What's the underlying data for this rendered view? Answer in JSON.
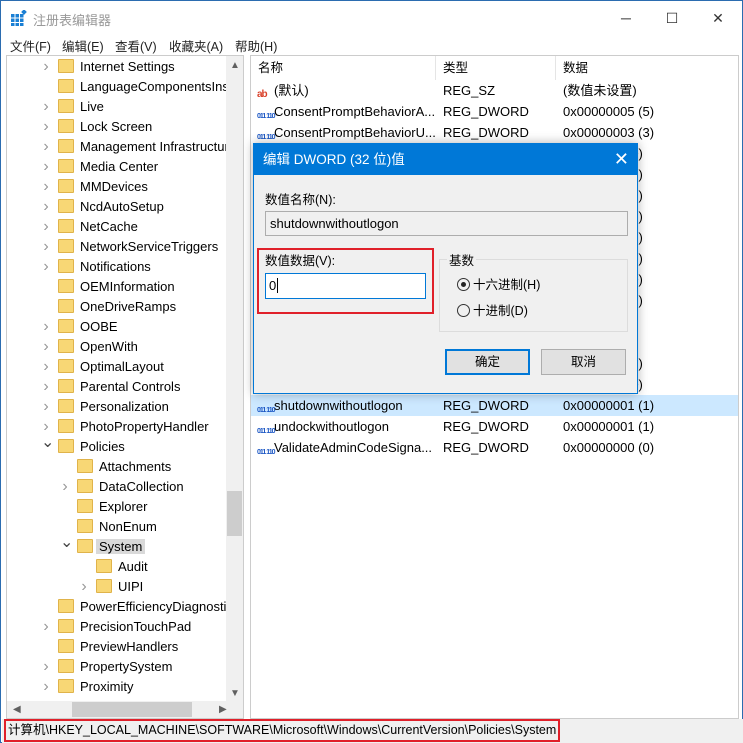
{
  "window": {
    "title": "注册表编辑器",
    "minimize": "─",
    "maximize": "☐",
    "close": "✕"
  },
  "menu": [
    "文件(F)",
    "编辑(E)",
    "查看(V)",
    "收藏夹(A)",
    "帮助(H)"
  ],
  "tree": [
    {
      "label": "Internet Settings",
      "level": 0,
      "exp": ">"
    },
    {
      "label": "LanguageComponentsInst",
      "level": 0,
      "exp": ""
    },
    {
      "label": "Live",
      "level": 0,
      "exp": ">"
    },
    {
      "label": "Lock Screen",
      "level": 0,
      "exp": ">"
    },
    {
      "label": "Management Infrastructur",
      "level": 0,
      "exp": ">"
    },
    {
      "label": "Media Center",
      "level": 0,
      "exp": ">"
    },
    {
      "label": "MMDevices",
      "level": 0,
      "exp": ">"
    },
    {
      "label": "NcdAutoSetup",
      "level": 0,
      "exp": ">"
    },
    {
      "label": "NetCache",
      "level": 0,
      "exp": ">"
    },
    {
      "label": "NetworkServiceTriggers",
      "level": 0,
      "exp": ">"
    },
    {
      "label": "Notifications",
      "level": 0,
      "exp": ">"
    },
    {
      "label": "OEMInformation",
      "level": 0,
      "exp": ""
    },
    {
      "label": "OneDriveRamps",
      "level": 0,
      "exp": ""
    },
    {
      "label": "OOBE",
      "level": 0,
      "exp": ">"
    },
    {
      "label": "OpenWith",
      "level": 0,
      "exp": ">"
    },
    {
      "label": "OptimalLayout",
      "level": 0,
      "exp": ">"
    },
    {
      "label": "Parental Controls",
      "level": 0,
      "exp": ">"
    },
    {
      "label": "Personalization",
      "level": 0,
      "exp": ">"
    },
    {
      "label": "PhotoPropertyHandler",
      "level": 0,
      "exp": ">"
    },
    {
      "label": "Policies",
      "level": 0,
      "exp": "v"
    },
    {
      "label": "Attachments",
      "level": 1,
      "exp": ""
    },
    {
      "label": "DataCollection",
      "level": 1,
      "exp": ">"
    },
    {
      "label": "Explorer",
      "level": 1,
      "exp": ""
    },
    {
      "label": "NonEnum",
      "level": 1,
      "exp": ""
    },
    {
      "label": "System",
      "level": 1,
      "exp": "v",
      "selected": true
    },
    {
      "label": "Audit",
      "level": 2,
      "exp": ""
    },
    {
      "label": "UIPI",
      "level": 2,
      "exp": ">"
    },
    {
      "label": "PowerEfficiencyDiagnostic",
      "level": 0,
      "exp": ""
    },
    {
      "label": "PrecisionTouchPad",
      "level": 0,
      "exp": ">"
    },
    {
      "label": "PreviewHandlers",
      "level": 0,
      "exp": ""
    },
    {
      "label": "PropertySystem",
      "level": 0,
      "exp": ">"
    },
    {
      "label": "Proximity",
      "level": 0,
      "exp": ">"
    }
  ],
  "list": {
    "headers": [
      "名称",
      "类型",
      "数据"
    ],
    "rows": [
      {
        "icon": "string-value-icon",
        "name": "(默认)",
        "type": "REG_SZ",
        "data": "(数值未设置)"
      },
      {
        "icon": "dword-value-icon",
        "name": "ConsentPromptBehaviorA...",
        "type": "REG_DWORD",
        "data": "0x00000005 (5)"
      },
      {
        "icon": "dword-value-icon",
        "name": "ConsentPromptBehaviorU...",
        "type": "REG_DWORD",
        "data": "0x00000003 (3)"
      },
      {
        "icon": "",
        "name": "",
        "type": "",
        "data": "(0)"
      },
      {
        "icon": "",
        "name": "",
        "type": "",
        "data": "(2)"
      },
      {
        "icon": "",
        "name": "",
        "type": "",
        "data": "(1)"
      },
      {
        "icon": "",
        "name": "",
        "type": "",
        "data": "(1)"
      },
      {
        "icon": "",
        "name": "",
        "type": "",
        "data": "(1)"
      },
      {
        "icon": "",
        "name": "",
        "type": "",
        "data": "(1)"
      },
      {
        "icon": "",
        "name": "",
        "type": "",
        "data": "(0)"
      },
      {
        "icon": "",
        "name": "",
        "type": "",
        "data": "(1)"
      },
      {
        "icon": "",
        "name": "",
        "type": "",
        "data": ""
      },
      {
        "icon": "",
        "name": "",
        "type": "",
        "data": ""
      },
      {
        "icon": "",
        "name": "",
        "type": "",
        "data": "(1)"
      },
      {
        "icon": "",
        "name": "",
        "type": "",
        "data": "(0)"
      },
      {
        "icon": "dword-value-icon",
        "name": "shutdownwithoutlogon",
        "type": "REG_DWORD",
        "data": "0x00000001 (1)",
        "selected": true
      },
      {
        "icon": "dword-value-icon",
        "name": "undockwithoutlogon",
        "type": "REG_DWORD",
        "data": "0x00000001 (1)"
      },
      {
        "icon": "dword-value-icon",
        "name": "ValidateAdminCodeSigna...",
        "type": "REG_DWORD",
        "data": "0x00000000 (0)"
      }
    ]
  },
  "status": {
    "path": "计算机\\HKEY_LOCAL_MACHINE\\SOFTWARE\\Microsoft\\Windows\\CurrentVersion\\Policies\\System"
  },
  "dialog": {
    "title": "编辑 DWORD (32 位)值",
    "close": "✕",
    "name_label": "数值名称(N):",
    "name_value": "shutdownwithoutlogon",
    "data_label": "数值数据(V):",
    "data_value": "0",
    "base_label": "基数",
    "hex_label": "十六进制(H)",
    "dec_label": "十进制(D)",
    "selected_base": "hex",
    "ok": "确定",
    "cancel": "取消"
  },
  "colors": {
    "accent": "#0078d7",
    "highlight": "#e0202a",
    "selection": "#cce8ff"
  }
}
